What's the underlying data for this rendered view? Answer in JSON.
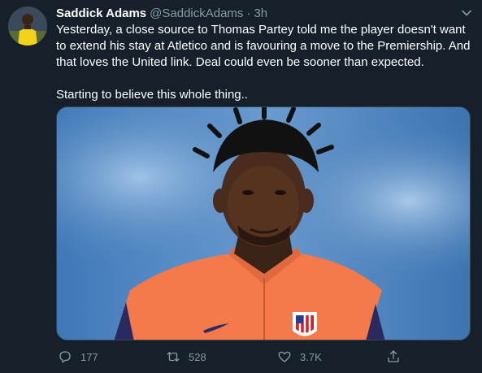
{
  "tweet": {
    "author_name": "Saddick Adams",
    "author_handle": "@SaddickAdams",
    "separator": "·",
    "time": "3h",
    "paragraphs": [
      "Yesterday, a close source to Thomas Partey told me the player doesn't want to extend his stay at Atletico and is favouring a move to the Premiership. And that loves the United link. Deal could even be sooner than expected.",
      "Starting to believe this whole thing.."
    ],
    "media": {
      "description_icon": "photo"
    },
    "actions": {
      "reply_count": "177",
      "retweet_count": "528",
      "like_count": "3.7K"
    }
  },
  "theme": {
    "background": "#15202b",
    "muted": "#8899a6",
    "text": "#ffffff",
    "border": "#38444d"
  },
  "icons": {
    "avatar": "avatar-photo",
    "caret": "chevron-down-icon",
    "reply": "reply-icon",
    "retweet": "retweet-icon",
    "like": "heart-icon",
    "share": "share-icon"
  }
}
